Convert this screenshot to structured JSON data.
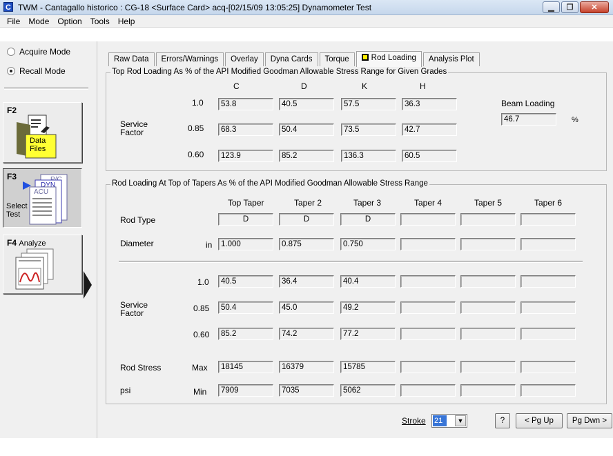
{
  "window": {
    "title": "TWM  -  Cantagallo historico : CG-18  <Surface Card>  acq-[02/15/09 13:05:25]  Dynamometer Test",
    "app_icon_glyph": "C"
  },
  "menu": [
    "File",
    "Mode",
    "Option",
    "Tools",
    "Help"
  ],
  "left": {
    "acquire_mode": "Acquire Mode",
    "recall_mode": "Recall Mode",
    "f2": {
      "key": "F2",
      "label_line1": "Data",
      "label_line2": "Files"
    },
    "f3": {
      "key": "F3",
      "label_line1": "Select",
      "label_line2": "Test",
      "doc_labels": [
        "P/C",
        "DYN",
        "ACU"
      ]
    },
    "f4": {
      "key": "F4",
      "label": "Analyze"
    }
  },
  "tabs": [
    "Raw Data",
    "Errors/Warnings",
    "Overlay",
    "Dyna Cards",
    "Torque",
    "Rod Loading",
    "Analysis Plot"
  ],
  "top_group": {
    "title": "Top Rod Loading As % of the API Modified Goodman Allowable Stress Range for Given Grades",
    "grades": [
      "C",
      "D",
      "K",
      "H"
    ],
    "service_factor_label_1": "Service",
    "service_factor_label_2": "Factor",
    "rows": [
      {
        "sf": "1.0",
        "values": [
          "53.8",
          "40.5",
          "57.5",
          "36.3"
        ]
      },
      {
        "sf": "0.85",
        "values": [
          "68.3",
          "50.4",
          "73.5",
          "42.7"
        ]
      },
      {
        "sf": "0.60",
        "values": [
          "123.9",
          "85.2",
          "136.3",
          "60.5"
        ]
      }
    ],
    "beam_loading_label": "Beam Loading",
    "beam_loading_value": "46.7",
    "beam_loading_unit": "%"
  },
  "taper_group": {
    "title": "Rod Loading At Top of Tapers As % of the API Modified Goodman Allowable Stress Range",
    "columns": [
      "Top Taper",
      "Taper 2",
      "Taper 3",
      "Taper 4",
      "Taper 5",
      "Taper 6"
    ],
    "rod_type_label": "Rod Type",
    "rod_types": [
      "D",
      "D",
      "D",
      "",
      "",
      ""
    ],
    "diameter_label": "Diameter",
    "diameter_unit": "in",
    "diameters": [
      "1.000",
      "0.875",
      "0.750",
      "",
      "",
      ""
    ],
    "service_factor_label_1": "Service",
    "service_factor_label_2": "Factor",
    "sf_rows": [
      {
        "sf": "1.0",
        "values": [
          "40.5",
          "36.4",
          "40.4",
          "",
          "",
          ""
        ]
      },
      {
        "sf": "0.85",
        "values": [
          "50.4",
          "45.0",
          "49.2",
          "",
          "",
          ""
        ]
      },
      {
        "sf": "0.60",
        "values": [
          "85.2",
          "74.2",
          "77.2",
          "",
          "",
          ""
        ]
      }
    ],
    "rod_stress_label": "Rod Stress",
    "psi_label": "psi",
    "max_label": "Max",
    "min_label": "Min",
    "max_values": [
      "18145",
      "16379",
      "15785",
      "",
      "",
      ""
    ],
    "min_values": [
      "7909",
      "7035",
      "5062",
      "",
      "",
      ""
    ]
  },
  "bottom": {
    "stroke_label": "Stroke",
    "stroke_value": "21",
    "help_label": "?",
    "pgup_label": "< Pg Up",
    "pgdn_label": "Pg Dwn >"
  },
  "colors": {
    "rod_loading_tab_marker": "#ffee00",
    "selected_stroke_bg": "#3875d7",
    "data_files_folder": "#ffff33"
  }
}
